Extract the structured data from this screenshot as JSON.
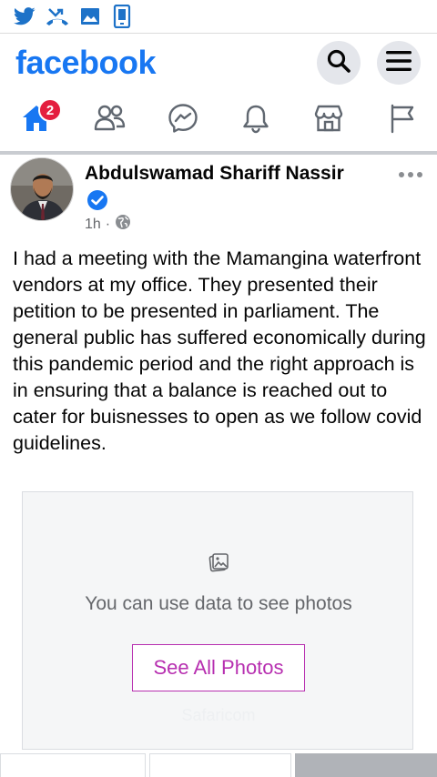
{
  "status_bar": {
    "icons": [
      "twitter-icon",
      "missed-call-icon",
      "image-icon",
      "phone-vibrate-icon"
    ]
  },
  "header": {
    "logo_text": "facebook",
    "buttons": [
      "search-icon",
      "menu-icon"
    ]
  },
  "nav": {
    "items": [
      "home-icon",
      "friends-icon",
      "messenger-icon",
      "notifications-icon",
      "marketplace-icon",
      "pages-icon"
    ],
    "home_badge": "2"
  },
  "post": {
    "author": "Abdulswamad Shariff Nassir",
    "verified": true,
    "time": "1h",
    "separator": "·",
    "privacy_icon": "globe-icon",
    "text": "I had a meeting with the Mamangina waterfront vendors at my office. They presented their petition to be presented in parliament. The general public has suffered economically during this pandemic period  and the right approach is in ensuring that a balance is reached out to cater for buisnesses to open as we follow covid guidelines.",
    "photo_placeholder": {
      "message": "You can use data to see photos",
      "button_label": "See All Photos",
      "watermark": "Safaricom"
    }
  },
  "colors": {
    "brand": "#1877f2",
    "badge": "#e41e3f",
    "see_photos": "#b72fb0",
    "status_icons": "#1d72c8"
  }
}
